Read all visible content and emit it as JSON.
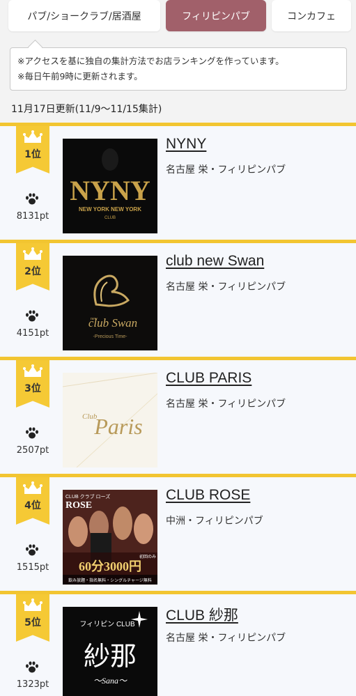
{
  "tabs": [
    {
      "label": "パブ/ショークラブ/居酒屋",
      "active": false
    },
    {
      "label": "フィリピンパブ",
      "active": true
    },
    {
      "label": "コンカフェ",
      "active": false
    }
  ],
  "notice": {
    "line1": "※アクセスを基に独自の集計方法でお店ランキングを作っています。",
    "line2": "※毎日午前9時に更新されます。"
  },
  "updated_text": "11月17日更新(11/9〜11/15集計)",
  "colors": {
    "accent_tab": "#a1606a",
    "rank_gold": "#f5c935",
    "divider_gold": "#f2c531"
  },
  "rankings": [
    {
      "rank": "1位",
      "points": "8131pt",
      "name": "NYNY",
      "area": "名古屋 栄・フィリピンパブ",
      "logo_text": "NYNY",
      "logo_sub": "NEW YORK NEW YORK",
      "logo_sub2": "CLUB"
    },
    {
      "rank": "2位",
      "points": "4151pt",
      "name": "club new Swan",
      "area": "名古屋 栄・フィリピンパブ",
      "logo_text": "club Swan",
      "logo_sub": "new",
      "logo_sub2": "-Precious Time-"
    },
    {
      "rank": "3位",
      "points": "2507pt",
      "name": "CLUB PARIS",
      "area": "名古屋 栄・フィリピンパブ",
      "logo_text": "Paris",
      "logo_sub": "Club",
      "logo_sub2": ""
    },
    {
      "rank": "4位",
      "points": "1515pt",
      "name": "CLUB ROSE",
      "area": "中洲・フィリピンパブ",
      "logo_text": "ROSE",
      "logo_sub": "CLUB クラブ ローズ",
      "logo_sub2": "60分3000円",
      "logo_sub3": "飲み放題・指名無料・シングルチャージ無料",
      "logo_sub4": "初回のみ"
    },
    {
      "rank": "5位",
      "points": "1323pt",
      "name": "CLUB 紗那",
      "area": "名古屋 栄・フィリピンパブ",
      "logo_text": "紗那",
      "logo_sub": "フィリピン CLUB",
      "logo_sub2": "〜Sana〜"
    }
  ]
}
